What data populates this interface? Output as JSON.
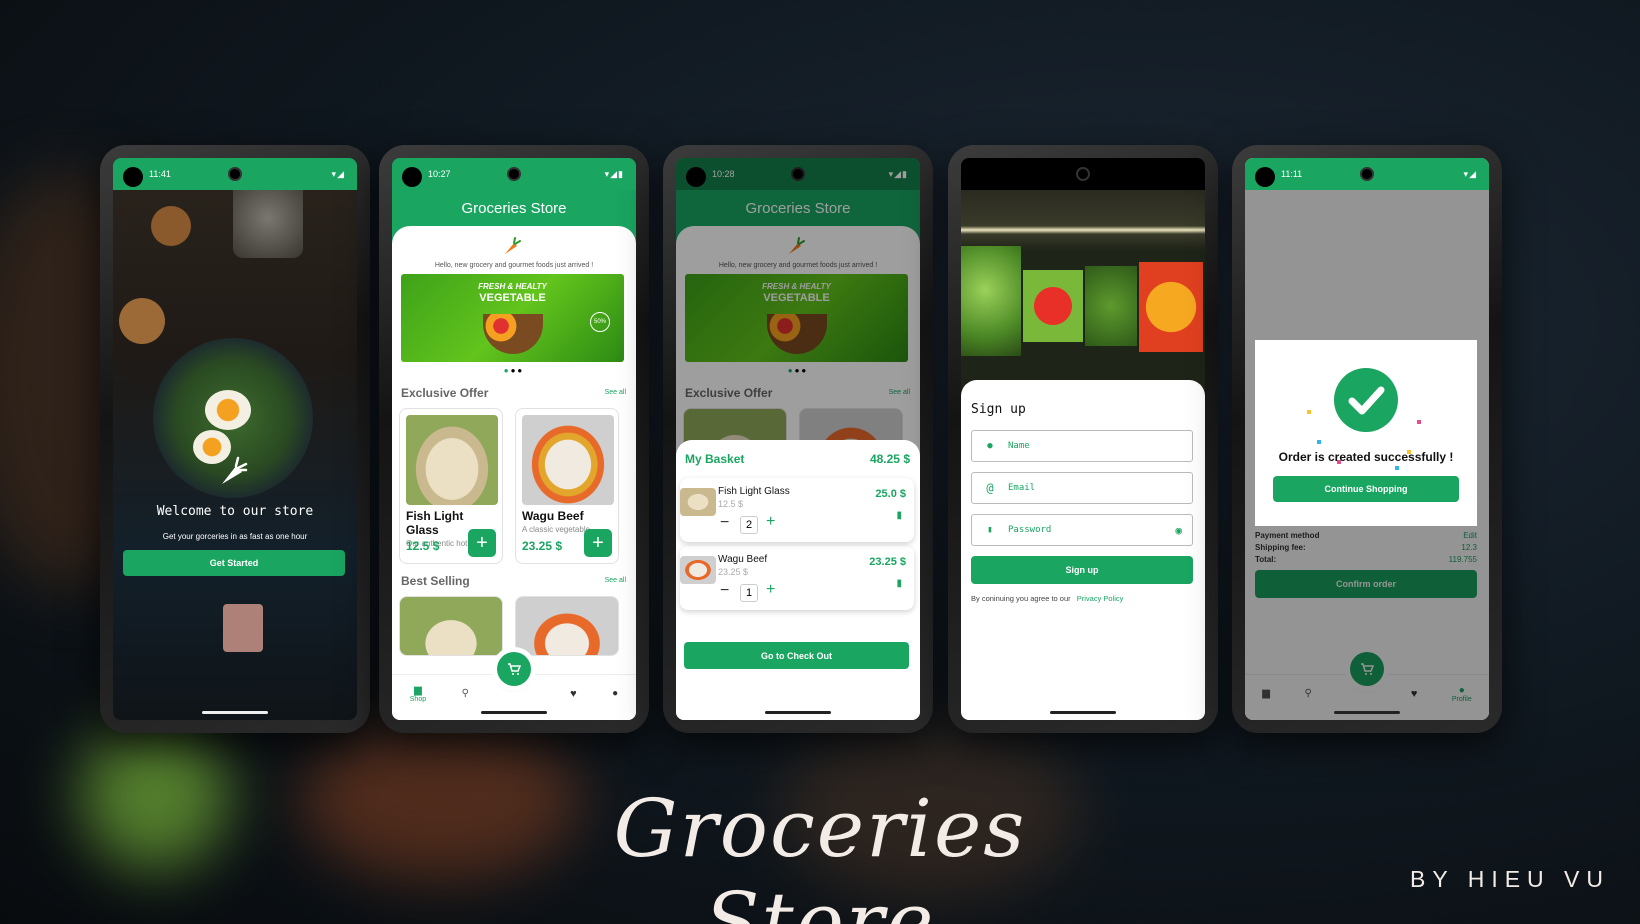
{
  "colors": {
    "brand_green": "#1aa561",
    "background": "#111a22",
    "text_dark": "#111111"
  },
  "promo": {
    "title": "Groceries Store",
    "author": "BY HIEU VU"
  },
  "phone1": {
    "time": "11:41",
    "welcome_title": "Welcome to our store",
    "welcome_subtitle": "Get your gorceries in as fast as one hour",
    "get_started": "Get Started",
    "logo_icon": "carrot-icon"
  },
  "phone2": {
    "time": "10:27",
    "header_title": "Groceries Store",
    "greeting": "Hello, new grocery and gourmet foods just arrived !",
    "banner_line1": "FRESH & HEALTY",
    "banner_line2": "VEGETABLE",
    "banner_badge": "50%",
    "exclusive_offer": "Exclusive Offer",
    "see_all": "See all",
    "best_selling": "Best Selling",
    "products": [
      {
        "name": "Fish Light Glass",
        "desc": "Our authentic hot",
        "price": "12.5 $"
      },
      {
        "name": "Wagu Beef",
        "desc": "A classic vegetable",
        "price": "23.25 $"
      }
    ],
    "nav": {
      "shop": "Shop"
    }
  },
  "phone3": {
    "time": "10:28",
    "header_title": "Groceries Store",
    "greeting": "Hello, new grocery and gourmet foods just arrived !",
    "banner_line1": "FRESH & HEALTY",
    "banner_line2": "VEGETABLE",
    "exclusive_offer": "Exclusive Offer",
    "see_all": "See all",
    "basket_title": "My Basket",
    "basket_total": "48.25 $",
    "items": [
      {
        "name": "Fish Light Glass",
        "unit_price": "12.5 $",
        "qty": "2",
        "total": "25.0 $"
      },
      {
        "name": "Wagu Beef",
        "unit_price": "23.25 $",
        "qty": "1",
        "total": "23.25 $"
      }
    ],
    "checkout": "Go to Check Out"
  },
  "phone4": {
    "title": "Sign up",
    "name_placeholder": "Name",
    "email_placeholder": "Email",
    "password_placeholder": "Password",
    "button": "Sign up",
    "terms_text": "By coninuing you agree to our",
    "privacy": "Privacy Policy"
  },
  "phone5": {
    "time": "11:11",
    "success_text": "Order is created successfully !",
    "continue": "Continue Shopping",
    "payment_method": "Payment method",
    "payment_edit": "Edit",
    "shipping_fee": "Shipping fee:",
    "shipping_value": "12.3",
    "total_label": "Total:",
    "total_value": "119.755",
    "confirm": "Confirm order",
    "nav_profile": "Profile"
  }
}
